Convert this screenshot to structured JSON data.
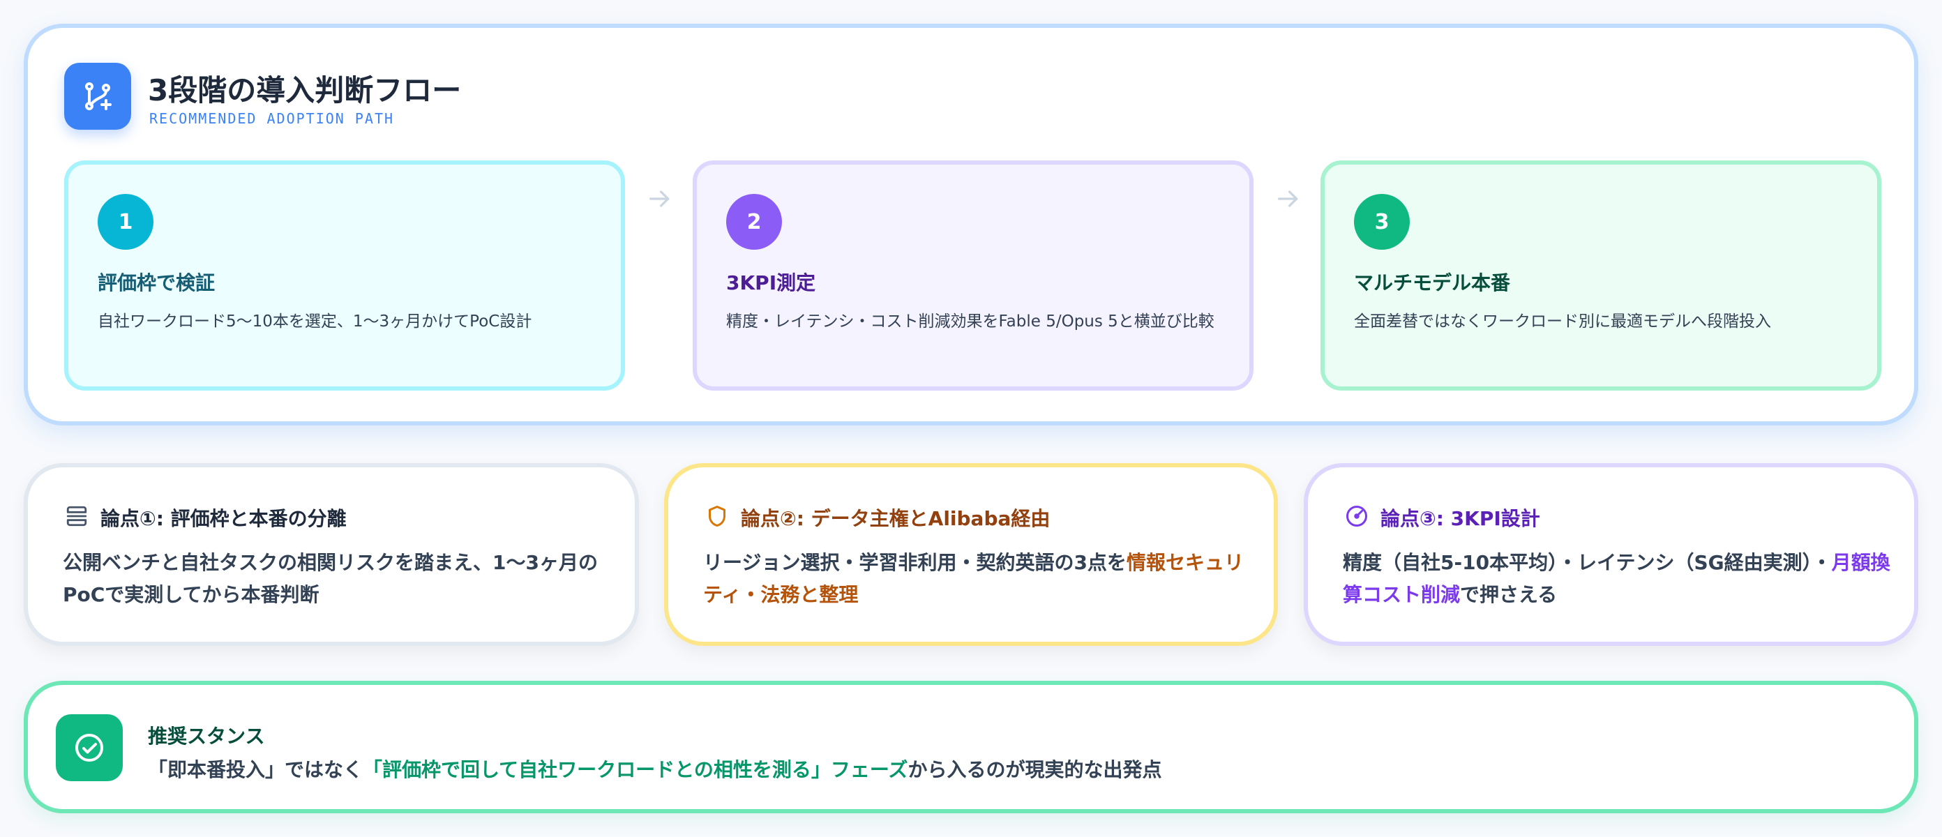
{
  "header": {
    "icon": "git-branch-plus-icon",
    "title": "3段階の導入判断フロー",
    "subtitle": "RECOMMENDED ADOPTION PATH"
  },
  "steps": [
    {
      "number": "1",
      "title": "評価枠で検証",
      "description": "自社ワークロード5〜10本を選定、1〜3ヶ月かけてPoC設計",
      "accent": "#06b6d4"
    },
    {
      "number": "2",
      "title": "3KPI測定",
      "description": "精度・レイテンシ・コスト削減効果をFable 5/Opus 5と横並び比較",
      "accent": "#8b5cf6"
    },
    {
      "number": "3",
      "title": "マルチモデル本番",
      "description": "全面差替ではなくワークロード別に最適モデルへ段階投入",
      "accent": "#10b981"
    }
  ],
  "arrows": [
    "arrow-right-icon",
    "arrow-right-icon"
  ],
  "points": [
    {
      "icon": "separator-icon",
      "title": "論点①: 評価枠と本番の分離",
      "body": "公開ベンチと自社タスクの相関リスクを踏まえ、1〜3ヶ月のPoCで実測してから本番判断",
      "highlight": ""
    },
    {
      "icon": "shield-icon",
      "title": "論点②: データ主権とAlibaba経由",
      "body": "リージョン選択・学習非利用・契約英語の3点を",
      "highlight": "情報セキュリティ・法務と整理",
      "accent": "#b45309"
    },
    {
      "icon": "gauge-icon",
      "title": "論点③: 3KPI設計",
      "body": "精度（自社5-10本平均）・レイテンシ（SG経由実測）・",
      "highlight": "月額換算コスト削減",
      "tail": "で押さえる",
      "accent": "#7c3aed"
    }
  ],
  "recommendation": {
    "icon": "check-circle-icon",
    "title": "推奨スタンス",
    "prefix": "「即本番投入」ではなく",
    "highlight": "「評価枠で回して自社ワークロードとの相性を測る」フェーズ",
    "suffix": "から入るのが現実的な出発点",
    "accent": "#059669"
  }
}
